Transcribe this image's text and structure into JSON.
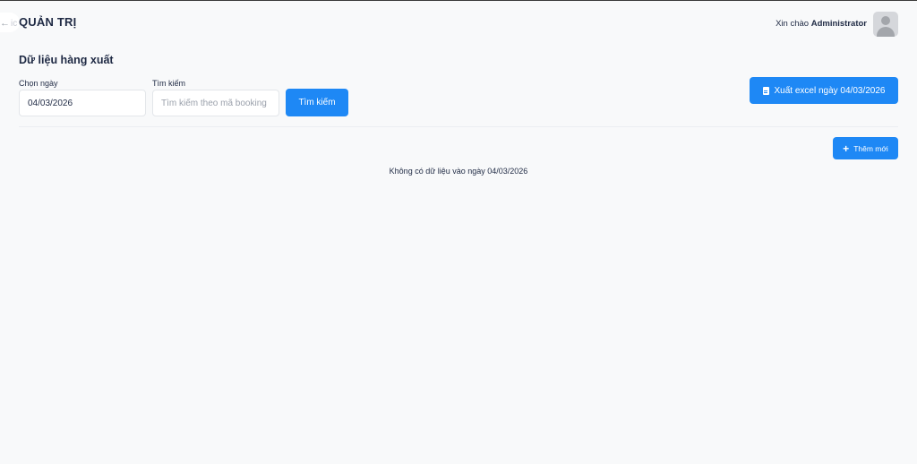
{
  "header": {
    "back_icon": "arrow-left-icon",
    "back_label": "ic",
    "brand": "QUẢN TRỊ",
    "greeting_prefix": "Xin chào",
    "username": "Administrator",
    "avatar_icon": "user-avatar-icon"
  },
  "page": {
    "title": "Dữ liệu hàng xuất"
  },
  "filters": {
    "date_label": "Chọn ngày",
    "date_value": "04/03/2026",
    "search_label": "Tìm kiếm",
    "search_placeholder": "Tìm kiếm theo mã booking",
    "search_value": "",
    "search_button": "Tìm kiếm"
  },
  "actions": {
    "export_label": "Xuất excel ngày 04/03/2026",
    "export_icon": "file-icon",
    "add_label": "Thêm mới",
    "add_icon": "plus-icon"
  },
  "content": {
    "empty_message": "Không có dữ liệu vào ngày 04/03/2026"
  },
  "colors": {
    "primary": "#1e88f5",
    "background": "#f8f9fa",
    "text": "#1f2a44"
  }
}
